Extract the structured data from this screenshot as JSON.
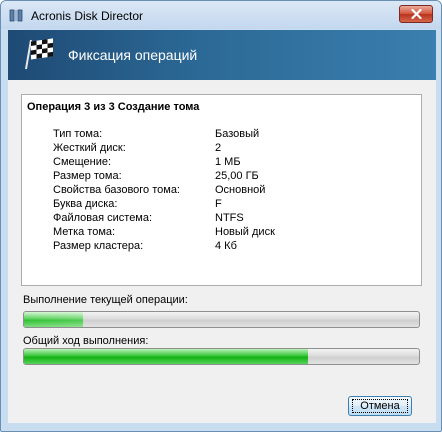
{
  "window": {
    "title": "Acronis Disk Director"
  },
  "header": {
    "title": "Фиксация операций"
  },
  "operation": {
    "title": "Операция 3 из 3 Создание тома",
    "properties": [
      {
        "label": "Тип тома:",
        "value": "Базовый"
      },
      {
        "label": "Жесткий диск:",
        "value": "2"
      },
      {
        "label": "Смещение:",
        "value": "1 МБ"
      },
      {
        "label": "Размер тома:",
        "value": "25,00 ГБ"
      },
      {
        "label": "Свойства базового тома:",
        "value": "Основной"
      },
      {
        "label": "Буква диска:",
        "value": "F"
      },
      {
        "label": "Файловая система:",
        "value": "NTFS"
      },
      {
        "label": "Метка тома:",
        "value": "Новый диск"
      },
      {
        "label": "Размер кластера:",
        "value": "4 Кб"
      }
    ]
  },
  "progress": {
    "current_label": "Выполнение текущей операции:",
    "current_fraction": 0.15,
    "overall_label": "Общий ход выполнения:",
    "overall_fraction": 0.72
  },
  "buttons": {
    "cancel_label": "Отмена"
  },
  "icons": {
    "app": "disk-director-icon",
    "header": "checkered-flag-icon",
    "close": "close-icon"
  },
  "colors": {
    "header_start": "#1e4a74",
    "header_end": "#3a7fae",
    "progress_green": "#14b316",
    "close_red": "#c8402a"
  }
}
